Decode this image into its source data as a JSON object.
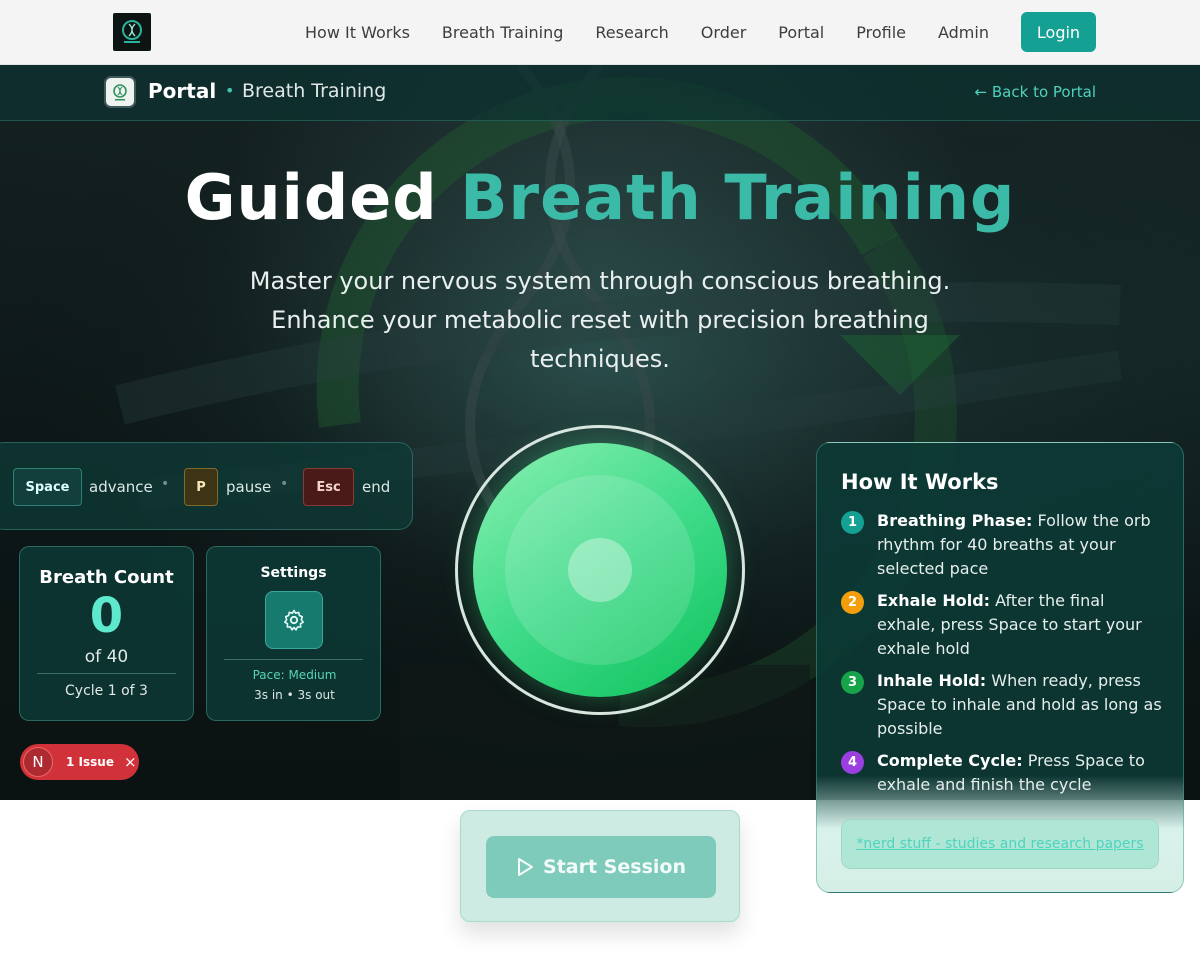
{
  "nav": {
    "links": [
      "How It Works",
      "Breath Training",
      "Research",
      "Order",
      "Portal",
      "Profile",
      "Admin"
    ],
    "login_label": "Login"
  },
  "sub_header": {
    "title": "Portal",
    "crumb": "Breath Training",
    "back_label": "← Back to Portal"
  },
  "hero": {
    "title_white": "Guided",
    "title_accent": "Breath Training",
    "subtitle": "Master your nervous system through conscious breathing. Enhance your metabolic reset with precision breathing techniques."
  },
  "shortcuts": {
    "space_key": "Space",
    "space_label": "advance",
    "p_key": "P",
    "p_label": "pause",
    "esc_key": "Esc",
    "esc_label": "end"
  },
  "breath_count": {
    "title": "Breath Count",
    "value": "0",
    "of_label": "of 40",
    "cycle_label": "Cycle 1 of 3"
  },
  "settings": {
    "title": "Settings",
    "pace": "Pace: Medium",
    "timing": "3s in • 3s out"
  },
  "issue": {
    "letter": "N",
    "label": "1 Issue",
    "close": "×"
  },
  "how": {
    "title": "How It Works",
    "steps": [
      {
        "num": "1",
        "name": "Breathing Phase:",
        "text": "Follow the orb rhythm for 40 breaths at your selected pace",
        "color": "#14a093"
      },
      {
        "num": "2",
        "name": "Exhale Hold:",
        "text": "After the final exhale, press Space to start your exhale hold",
        "color": "#f59e0b"
      },
      {
        "num": "3",
        "name": "Inhale Hold:",
        "text": "When ready, press Space to inhale and hold as long as possible",
        "color": "#16a34a"
      },
      {
        "num": "4",
        "name": "Complete Cycle:",
        "text": "Press Space to exhale and finish the cycle",
        "color": "#9b3fe0"
      }
    ],
    "link": "*nerd stuff - studies and research papers"
  },
  "start": {
    "label": "Start Session"
  }
}
